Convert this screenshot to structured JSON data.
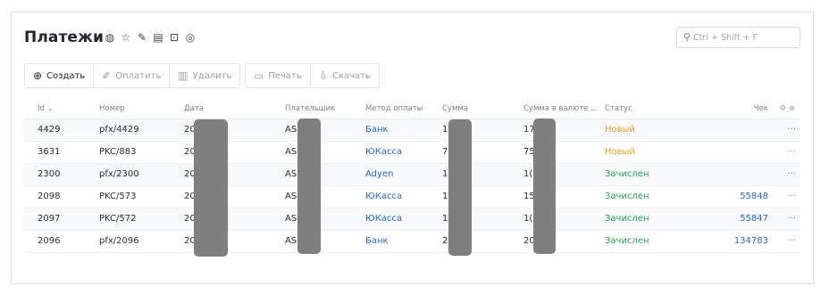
{
  "header": {
    "title": "Платежи",
    "icons": [
      "globe-icon",
      "star-icon",
      "pin-icon",
      "document-icon",
      "export-icon",
      "help-icon"
    ]
  },
  "search": {
    "placeholder": "Ctrl + Shift + F"
  },
  "toolbar": {
    "create": "Создать",
    "pay": "Оплатить",
    "delete": "Удалить",
    "print": "Печать",
    "download": "Скачать"
  },
  "table": {
    "columns": {
      "id": "Id",
      "number": "Номер",
      "date": "Дата",
      "payer": "Плательщик",
      "method": "Метод оплаты",
      "sum": "Сумма",
      "sum_currency": "Сумма в валюте ...",
      "status": "Статус",
      "check": "Чек"
    },
    "rows": [
      {
        "id": "4429",
        "number": "pfx/4429",
        "date": "20",
        "payer": "ASI",
        "method": "Банк",
        "sum": "17",
        "sum_currency": "17",
        "status": "Новый",
        "check": ""
      },
      {
        "id": "3631",
        "number": "PKC/883",
        "date": "20",
        "payer": "ASI",
        "method": "ЮКасса",
        "sum": "75",
        "sum_currency": "75",
        "status": "Новый",
        "check": ""
      },
      {
        "id": "2300",
        "number": "pfx/2300",
        "date": "20",
        "payer": "ASI",
        "method": "Adyen",
        "sum": "1(",
        "sum_currency": "1(",
        "status": "Зачислен",
        "check": ""
      },
      {
        "id": "2098",
        "number": "PKC/573",
        "date": "20",
        "payer": "ASI",
        "method": "ЮКасса",
        "sum": "15",
        "sum_currency": "15",
        "status": "Зачислен",
        "check": "55848"
      },
      {
        "id": "2097",
        "number": "PKC/572",
        "date": "20",
        "payer": "ASI",
        "method": "ЮКасса",
        "sum": "1(",
        "sum_currency": "1(",
        "status": "Зачислен",
        "check": "55847"
      },
      {
        "id": "2096",
        "number": "pfx/2096",
        "date": "20",
        "payer": "ASI",
        "method": "Банк",
        "sum": "2(",
        "sum_currency": "20",
        "status": "Зачислен",
        "check": "134783"
      }
    ]
  },
  "colors": {
    "new": "#e8a21a",
    "credited": "#23a352",
    "link": "#2469d6"
  }
}
